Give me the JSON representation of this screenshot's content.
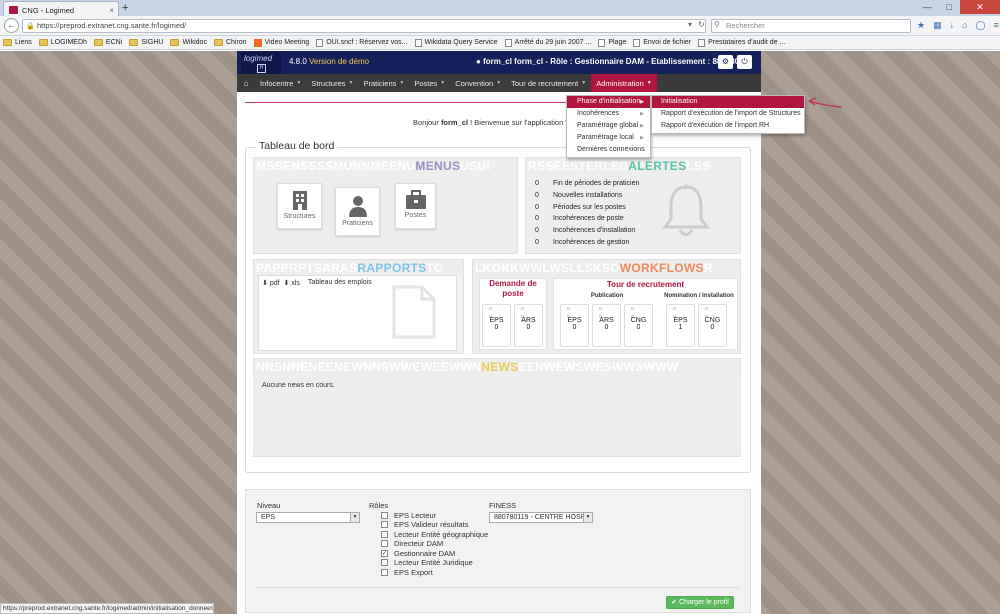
{
  "browser": {
    "tab_title": "CNG - Logimed",
    "tab_close": "×",
    "new_tab": "+",
    "url": "https://preprod.extranet.cng.sante.fr/logimed/",
    "search_placeholder": "Rechercher",
    "bookmarks": [
      "Liens",
      "LOGIMEDh",
      "ECNi",
      "SIGHU",
      "Wikidoc",
      "Chiron",
      "Video Meeting",
      "OUI.sncf : Réservez vos...",
      "Wikidata Query Service",
      "Arrêté du 29 juin 2007 ...",
      "Plage",
      "Envoi de fichier",
      "Prestataires d'audit de ..."
    ],
    "status_url": "https://preprod.extranet.cng.sante.fr/logimed/admin/initialisation_donnees"
  },
  "header": {
    "logo": "logimed",
    "logo_badge": "H",
    "version": "4.8.0",
    "version_note": "Version de démo",
    "user": "form_cl form_cl - Rôle : Gestionnaire DAM - Etablissement : 880780119"
  },
  "menu": [
    "Infocentre",
    "Structures",
    "Praticiens",
    "Postes",
    "Convention",
    "Tour de recrutement",
    "Administration"
  ],
  "dropdown": {
    "items": [
      "Phase d'initialisation",
      "Incohérences",
      "Paramétrage global",
      "Paramétrage local",
      "Dernières connexions"
    ],
    "submenu": [
      "Initialisation",
      "Rapport d'exécution de l'import de Structures",
      "Rapport d'exécution de l'import RH"
    ]
  },
  "welcome": {
    "prefix": "Bonjour ",
    "user": "form_cl",
    "suffix": " ! Bienvenue sur l'application \"Logi"
  },
  "dashboard": {
    "title": "Tableau de bord",
    "menus": {
      "ghost": "MSSENSSSSMUNNMEENU",
      "label": "MENUS",
      "ghost2": "USUI"
    },
    "tiles": [
      "Structures",
      "Praticiens",
      "Postes"
    ],
    "alertes": {
      "ghost": "RSSEESTERLED",
      "label": "ALERTES",
      "ghost2": "LSS",
      "rows": [
        {
          "count": "0",
          "text": "Fin de périodes de praticien"
        },
        {
          "count": "0",
          "text": "Nouvelles installations"
        },
        {
          "count": "0",
          "text": "Périodes sur les postes"
        },
        {
          "count": "0",
          "text": "Incohérences de poste"
        },
        {
          "count": "0",
          "text": "Incohérences d'installation"
        },
        {
          "count": "0",
          "text": "Incohérences de gestion"
        }
      ]
    },
    "rapports": {
      "ghost": "PAPPRPTSARAS",
      "label": "RAPPORTS",
      "ghost2": "TO",
      "pdf": "pdf",
      "xls": "xls",
      "item": "Tableau des emplois"
    },
    "workflows": {
      "ghost": "LKOKKWWLWSLLSKSO",
      "label": "WORKFLOWS",
      "ghost2": "R",
      "demande_title": "Demande de poste",
      "tour_title": "Tour de recrutement",
      "publication": "Publication",
      "nomination": "Nomination / Installation",
      "demande": [
        {
          "name": "EPS",
          "value": "0"
        },
        {
          "name": "ARS",
          "value": "0"
        }
      ],
      "publication_boxes": [
        {
          "name": "EPS",
          "value": "0"
        },
        {
          "name": "ARS",
          "value": "0"
        },
        {
          "name": "CNG",
          "value": "0"
        }
      ],
      "nomination_boxes": [
        {
          "name": "EPS",
          "value": "1"
        },
        {
          "name": "CNG",
          "value": "0"
        }
      ]
    },
    "news": {
      "ghost": "NNSNNENEENEWNNSWWEWEEWWN",
      "label": "NEWS",
      "ghost2": "EENWEWSWESWWSWWW",
      "empty": "Aucune news en cours."
    }
  },
  "form": {
    "niveau_label": "Niveau",
    "niveau_value": "EPS",
    "roles_label": "Rôles",
    "roles": [
      {
        "label": "EPS Lecteur",
        "checked": false
      },
      {
        "label": "EPS Valideur résultats",
        "checked": false
      },
      {
        "label": "Lecteur Entité géographique",
        "checked": false
      },
      {
        "label": "Directeur DAM",
        "checked": false
      },
      {
        "label": "Gestionnaire DAM",
        "checked": true
      },
      {
        "label": "Lecteur Entité Juridique",
        "checked": false
      },
      {
        "label": "EPS Export",
        "checked": false
      }
    ],
    "finess_label": "FINESS",
    "finess_value": "880780119 - CENTRE HOSP",
    "submit": "Charger le profil"
  },
  "colors": {
    "brand": "#b0163f",
    "header": "#15205a",
    "menus": "#9b8fc4",
    "alertes": "#5bc2a8",
    "rapports": "#7ec3e6",
    "workflows": "#ef8a5a",
    "news": "#e9cd53"
  }
}
